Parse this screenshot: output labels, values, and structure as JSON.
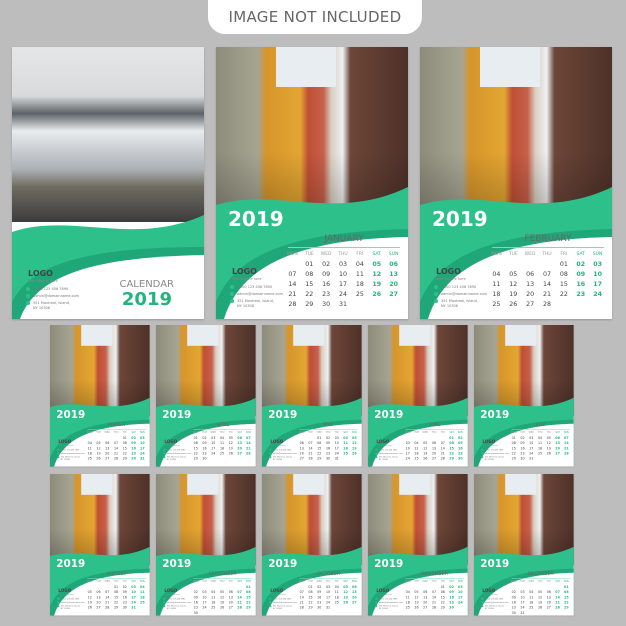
{
  "banner": "IMAGE NOT INCLUDED",
  "year": "2019",
  "colors": {
    "accent": "#2ec08a",
    "accent_dark": "#1fa77a",
    "background": "#bdbdbd"
  },
  "cover": {
    "title": "CALENDAR",
    "year": "2019"
  },
  "logo": {
    "text": "LOGO",
    "tagline": "Your tagline here"
  },
  "contact": {
    "phone": "+000 123 456 7890",
    "email": "admin@domainname.com",
    "address_1": "351 Montreal, Island,",
    "address_2": "NY 10308",
    "icons": [
      "phone-icon",
      "email-icon",
      "location-pin-icon"
    ]
  },
  "weekdays": [
    "MON",
    "TUE",
    "WED",
    "THU",
    "FRI",
    "SAT",
    "SUN"
  ],
  "months": [
    {
      "name": "JANUARY",
      "start": 1,
      "days": 31
    },
    {
      "name": "FEBRUARY",
      "start": 4,
      "days": 28
    },
    {
      "name": "MARCH",
      "start": 4,
      "days": 31
    },
    {
      "name": "APRIL",
      "start": 0,
      "days": 30
    },
    {
      "name": "MAY",
      "start": 2,
      "days": 31
    },
    {
      "name": "JUNE",
      "start": 5,
      "days": 30
    },
    {
      "name": "JULY",
      "start": 0,
      "days": 31
    },
    {
      "name": "AUGUST",
      "start": 3,
      "days": 31
    },
    {
      "name": "SEPTEMBER",
      "start": 6,
      "days": 30
    },
    {
      "name": "OCTOBER",
      "start": 1,
      "days": 31
    },
    {
      "name": "NOVEMBER",
      "start": 4,
      "days": 30
    },
    {
      "name": "DECEMBER",
      "start": 6,
      "days": 31
    }
  ]
}
